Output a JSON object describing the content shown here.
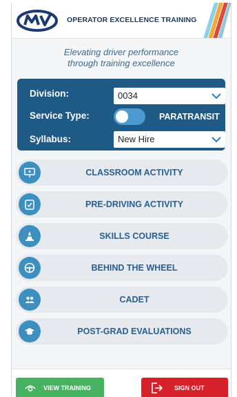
{
  "header": {
    "title": "OPERATOR EXCELLENCE TRAINING",
    "logo_icon": "mv-logo-icon"
  },
  "tagline": {
    "line1": "Elevating driver performance",
    "line2": "through training excellence"
  },
  "settings": {
    "division_label": "Division:",
    "division_value": "0034",
    "service_type_label": "Service Type:",
    "service_type_value": "PARATRANSIT",
    "syllabus_label": "Syllabus:",
    "syllabus_value": "New Hire"
  },
  "menu": [
    {
      "label": "CLASSROOM ACTIVITY",
      "icon": "presentation-board-icon"
    },
    {
      "label": "PRE-DRIVING ACTIVITY",
      "icon": "clipboard-check-icon"
    },
    {
      "label": "SKILLS COURSE",
      "icon": "traffic-cone-icon"
    },
    {
      "label": "BEHIND THE WHEEL",
      "icon": "steering-wheel-icon"
    },
    {
      "label": "CADET",
      "icon": "people-icon"
    },
    {
      "label": "POST-GRAD EVALUATIONS",
      "icon": "graduation-cap-icon"
    }
  ],
  "footer": {
    "view_training_label": "VIEW TRAINING",
    "sign_out_label": "SIGN OUT"
  },
  "colors": {
    "panel": "#1f5986",
    "menu_text": "#285f8f",
    "icon_circle": "#3c8fbf",
    "view_button": "#47b361",
    "sign_out_button": "#d6202a"
  }
}
